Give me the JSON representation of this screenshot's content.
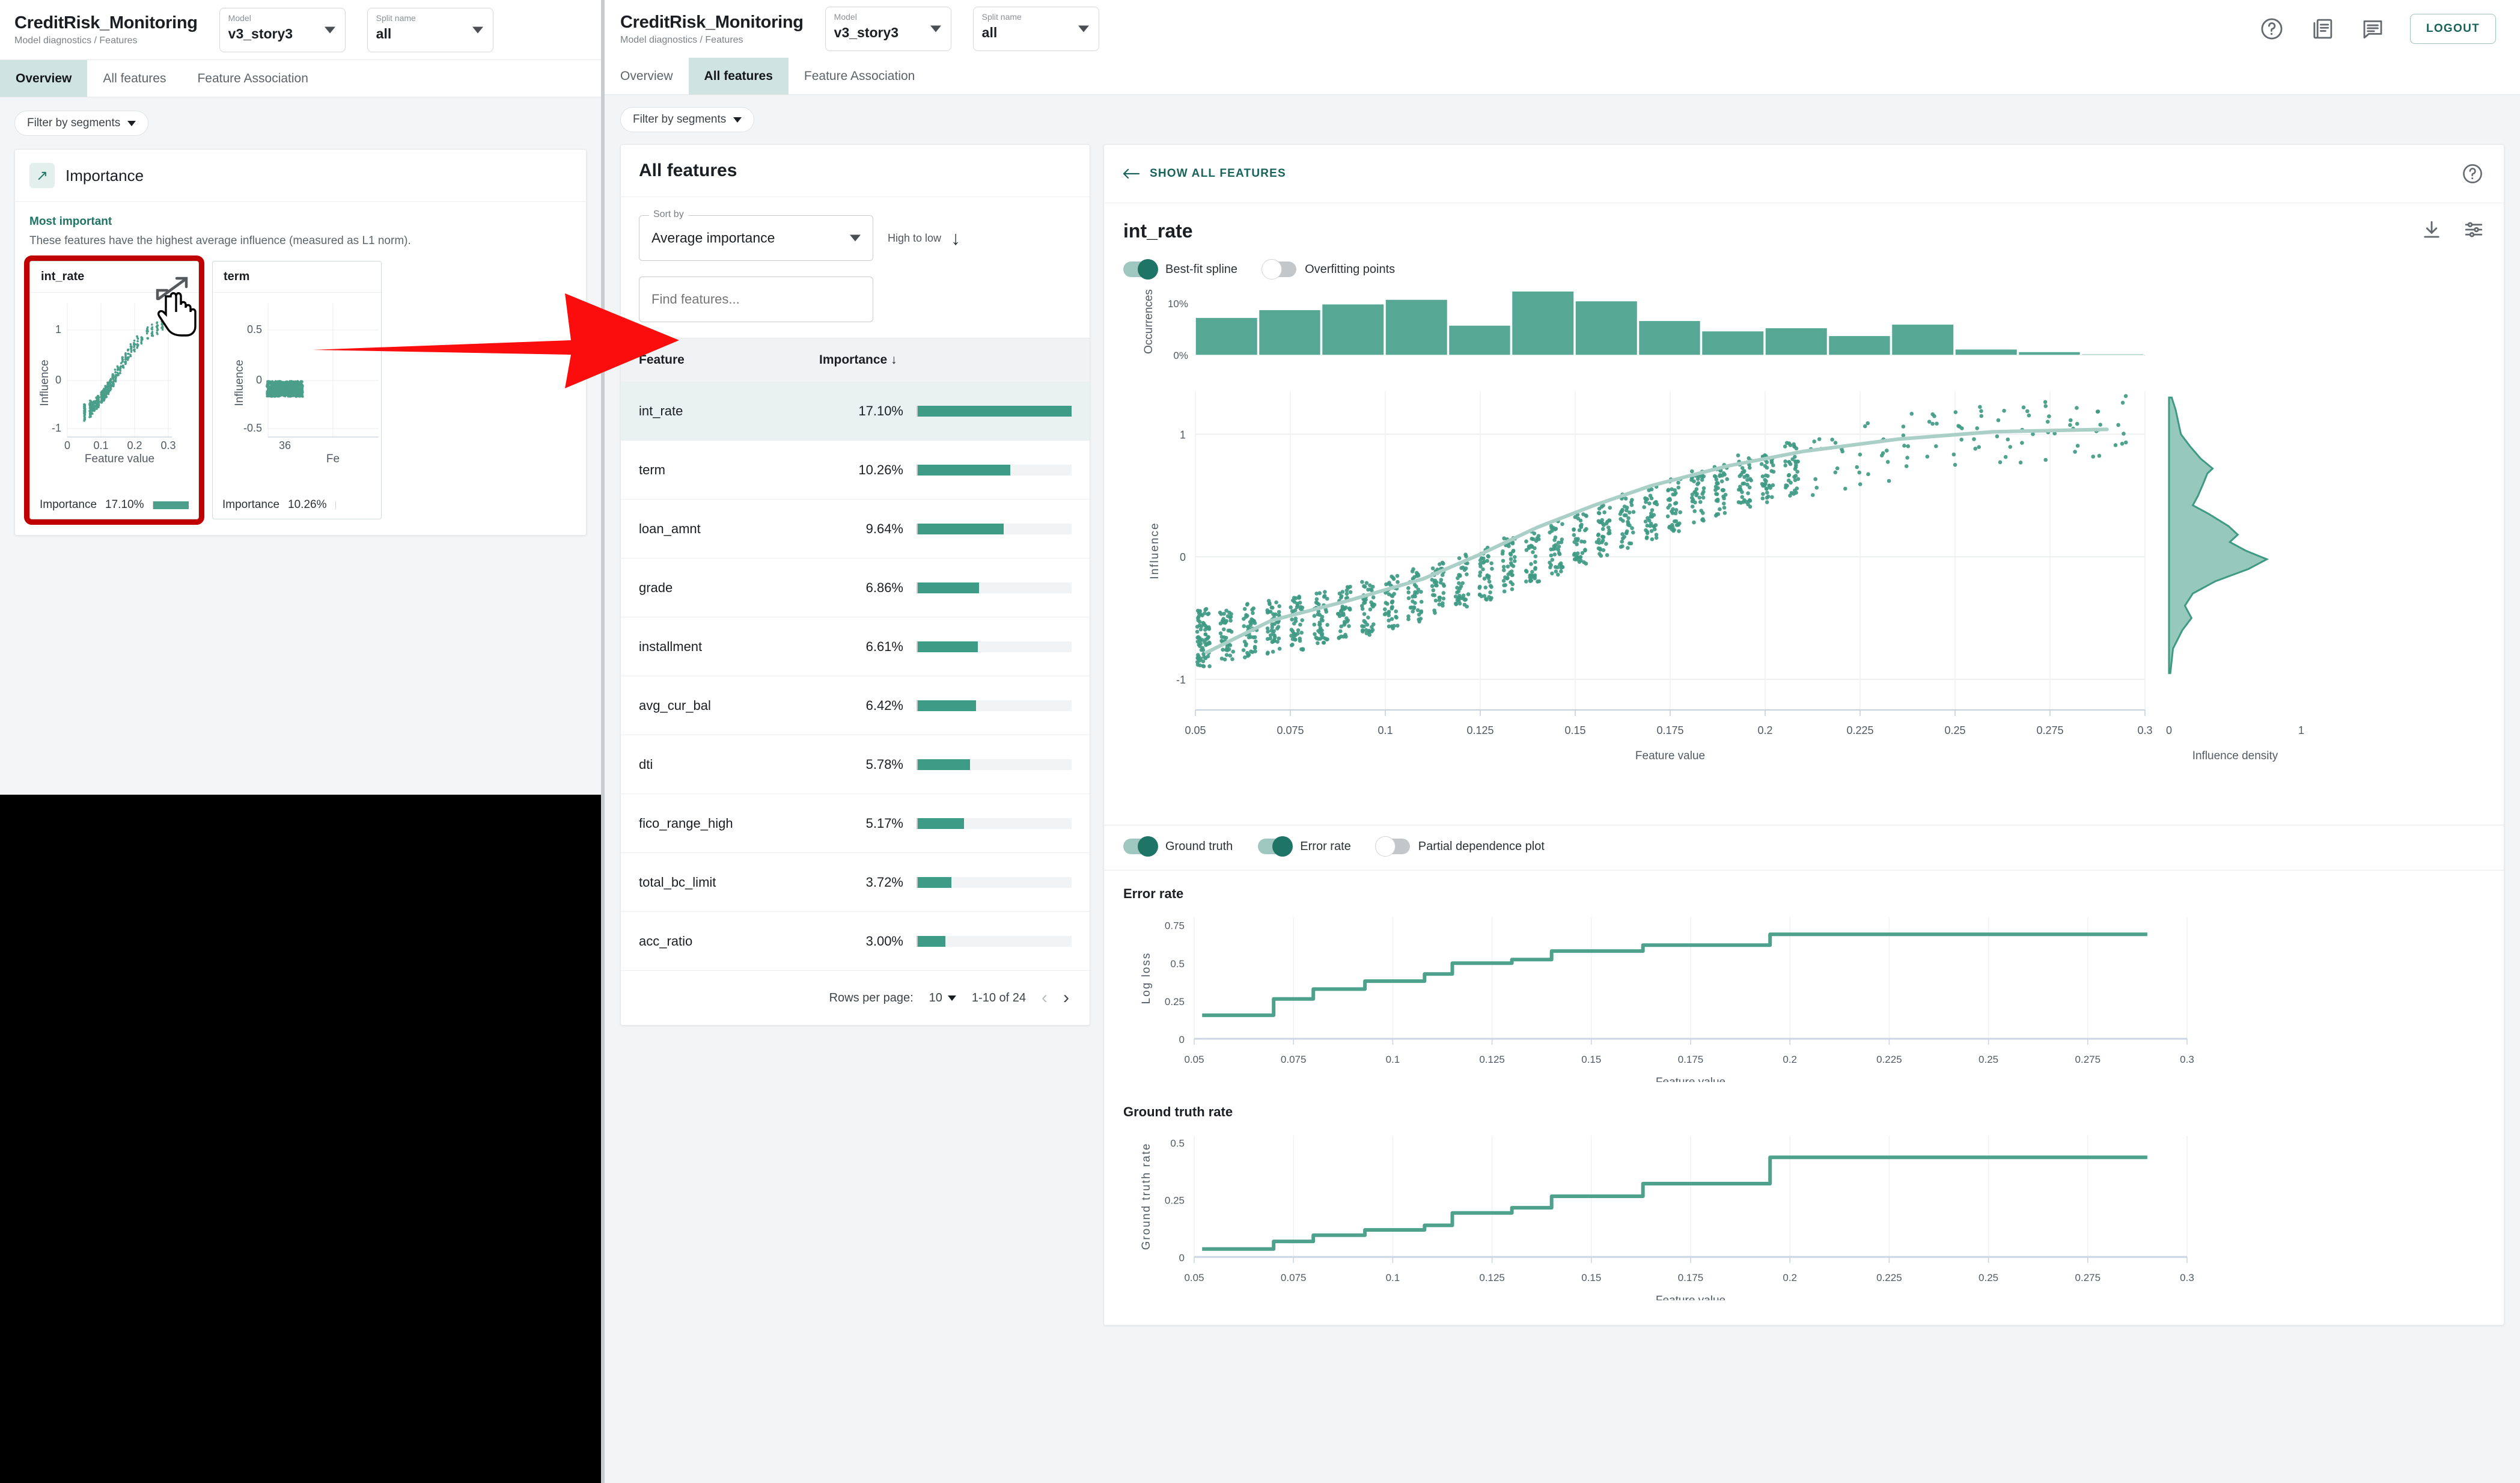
{
  "app": {
    "title": "CreditRisk_Monitoring",
    "breadcrumb": "Model diagnostics / Features",
    "model_label": "Model",
    "model_value": "v3_story3",
    "split_label": "Split name",
    "split_value": "all",
    "logout_label": "LOGOUT"
  },
  "tabs": {
    "overview": "Overview",
    "all_features": "All features",
    "feature_association": "Feature Association"
  },
  "toolbar": {
    "filter_segments": "Filter by segments"
  },
  "left_window": {
    "importance_card_title": "Importance",
    "most_important": "Most important",
    "most_important_desc": "These features have the highest average influence (measured as L1 norm).",
    "importance_label": "Importance",
    "mini_cards": [
      {
        "feature": "int_rate",
        "importance": "17.10%",
        "importance_pct": 100,
        "xlabel": "Feature value",
        "ylabel": "Influence",
        "xticks": [
          "0",
          "0.1",
          "0.2",
          "0.3"
        ],
        "yticks": [
          "1",
          "0",
          "-1"
        ]
      },
      {
        "feature": "term",
        "importance": "10.26%",
        "importance_pct": 60,
        "xlabel": "Feature value",
        "ylabel": "Influence",
        "xticks": [
          "36"
        ],
        "yticks": [
          "0.5",
          "0",
          "-0.5"
        ]
      }
    ]
  },
  "features_panel": {
    "title": "All features",
    "sort_legend": "Sort by",
    "sort_value": "Average importance",
    "sort_direction": "High to low",
    "search_placeholder": "Find features...",
    "col_feature": "Feature",
    "col_importance": "Importance",
    "rows": [
      {
        "feature": "int_rate",
        "importance": "17.10%",
        "pct": 100
      },
      {
        "feature": "term",
        "importance": "10.26%",
        "pct": 60
      },
      {
        "feature": "loan_amnt",
        "importance": "9.64%",
        "pct": 56
      },
      {
        "feature": "grade",
        "importance": "6.86%",
        "pct": 40
      },
      {
        "feature": "installment",
        "importance": "6.61%",
        "pct": 39
      },
      {
        "feature": "avg_cur_bal",
        "importance": "6.42%",
        "pct": 38
      },
      {
        "feature": "dti",
        "importance": "5.78%",
        "pct": 34
      },
      {
        "feature": "fico_range_high",
        "importance": "5.17%",
        "pct": 30
      },
      {
        "feature": "total_bc_limit",
        "importance": "3.72%",
        "pct": 22
      },
      {
        "feature": "acc_ratio",
        "importance": "3.00%",
        "pct": 18
      }
    ],
    "rows_per_page_label": "Rows per page:",
    "rows_per_page_value": "10",
    "range_label": "1-10 of 24"
  },
  "detail_panel": {
    "show_all_features": "SHOW ALL FEATURES",
    "feature_name": "int_rate",
    "toggles_top": [
      {
        "label": "Best-fit spline",
        "on": true
      },
      {
        "label": "Overfitting points",
        "on": false
      }
    ],
    "toggles_bottom": [
      {
        "label": "Ground truth",
        "on": true
      },
      {
        "label": "Error rate",
        "on": true
      },
      {
        "label": "Partial dependence plot",
        "on": false
      }
    ]
  },
  "chart_data": [
    {
      "id": "feature-histogram",
      "type": "bar",
      "title": "",
      "xlabel": "",
      "ylabel": "Occurrences",
      "yticks": [
        "0%",
        "10%"
      ],
      "ylim": [
        0,
        13
      ],
      "xlim": [
        0.05,
        0.3
      ],
      "bin_edges": [
        0.05,
        0.0667,
        0.0833,
        0.1,
        0.1167,
        0.1333,
        0.15,
        0.1667,
        0.1833,
        0.2,
        0.2167,
        0.2333,
        0.25,
        0.2667,
        0.2833,
        0.3
      ],
      "values": [
        7.3,
        8.8,
        9.9,
        10.8,
        5.8,
        12.4,
        10.5,
        6.7,
        4.7,
        5.3,
        3.8,
        6.0,
        1.2,
        0.7,
        0.25
      ]
    },
    {
      "id": "influence-scatter",
      "type": "scatter",
      "title": "int_rate",
      "xlabel": "Feature value",
      "ylabel": "Influence",
      "xticks": [
        "0.05",
        "0.075",
        "0.1",
        "0.125",
        "0.15",
        "0.175",
        "0.2",
        "0.225",
        "0.25",
        "0.275",
        "0.3"
      ],
      "yticks": [
        "1",
        "0",
        "-1"
      ],
      "xlim": [
        0.05,
        0.3
      ],
      "ylim": [
        -1.25,
        1.35
      ],
      "spline_label": "Best-fit spline",
      "spline_points": [
        [
          0.053,
          -0.78
        ],
        [
          0.07,
          -0.52
        ],
        [
          0.09,
          -0.36
        ],
        [
          0.11,
          -0.18
        ],
        [
          0.125,
          0.02
        ],
        [
          0.14,
          0.24
        ],
        [
          0.155,
          0.42
        ],
        [
          0.17,
          0.58
        ],
        [
          0.19,
          0.74
        ],
        [
          0.21,
          0.86
        ],
        [
          0.235,
          0.96
        ],
        [
          0.26,
          1.02
        ],
        [
          0.29,
          1.04
        ]
      ]
    },
    {
      "id": "influence-density",
      "type": "area",
      "xlabel": "Influence density",
      "xticks": [
        "0",
        "1"
      ],
      "xlim": [
        0,
        1
      ],
      "ylim": [
        -1.25,
        1.35
      ],
      "density": [
        [
          1.3,
          0.02
        ],
        [
          1.2,
          0.05
        ],
        [
          1.1,
          0.07
        ],
        [
          1.0,
          0.09
        ],
        [
          0.9,
          0.16
        ],
        [
          0.8,
          0.24
        ],
        [
          0.72,
          0.33
        ],
        [
          0.68,
          0.29
        ],
        [
          0.6,
          0.26
        ],
        [
          0.5,
          0.22
        ],
        [
          0.42,
          0.18
        ],
        [
          0.35,
          0.3
        ],
        [
          0.25,
          0.45
        ],
        [
          0.18,
          0.52
        ],
        [
          0.12,
          0.46
        ],
        [
          0.05,
          0.58
        ],
        [
          -0.02,
          0.74
        ],
        [
          -0.1,
          0.6
        ],
        [
          -0.2,
          0.35
        ],
        [
          -0.3,
          0.18
        ],
        [
          -0.4,
          0.12
        ],
        [
          -0.5,
          0.17
        ],
        [
          -0.6,
          0.1
        ],
        [
          -0.75,
          0.03
        ],
        [
          -0.95,
          0.01
        ]
      ]
    },
    {
      "id": "error-rate",
      "type": "line",
      "title": "Error rate",
      "xlabel": "Feature value",
      "ylabel": "Log loss",
      "yticks": [
        "0",
        "0.25",
        "0.5",
        "0.75"
      ],
      "xticks": [
        "0.05",
        "0.075",
        "0.1",
        "0.125",
        "0.15",
        "0.175",
        "0.2",
        "0.225",
        "0.25",
        "0.275",
        "0.3"
      ],
      "ylim": [
        0,
        0.8
      ],
      "xlim": [
        0.05,
        0.3
      ],
      "steps": [
        [
          0.052,
          0.155
        ],
        [
          0.07,
          0.155
        ],
        [
          0.07,
          0.262
        ],
        [
          0.08,
          0.262
        ],
        [
          0.08,
          0.327
        ],
        [
          0.093,
          0.327
        ],
        [
          0.093,
          0.38
        ],
        [
          0.108,
          0.38
        ],
        [
          0.108,
          0.427
        ],
        [
          0.115,
          0.427
        ],
        [
          0.115,
          0.498
        ],
        [
          0.13,
          0.498
        ],
        [
          0.13,
          0.522
        ],
        [
          0.14,
          0.522
        ],
        [
          0.14,
          0.578
        ],
        [
          0.163,
          0.578
        ],
        [
          0.163,
          0.617
        ],
        [
          0.195,
          0.617
        ],
        [
          0.195,
          0.688
        ],
        [
          0.29,
          0.688
        ]
      ]
    },
    {
      "id": "ground-truth-rate",
      "type": "line",
      "title": "Ground truth rate",
      "xlabel": "Feature value",
      "ylabel": "Ground truth rate",
      "yticks": [
        "0",
        "0.25",
        "0.5"
      ],
      "xticks": [
        "0.05",
        "0.075",
        "0.1",
        "0.125",
        "0.15",
        "0.175",
        "0.2",
        "0.225",
        "0.25",
        "0.275",
        "0.3"
      ],
      "ylim": [
        0,
        0.53
      ],
      "xlim": [
        0.05,
        0.3
      ],
      "steps": [
        [
          0.052,
          0.035
        ],
        [
          0.07,
          0.035
        ],
        [
          0.07,
          0.068
        ],
        [
          0.08,
          0.068
        ],
        [
          0.08,
          0.095
        ],
        [
          0.093,
          0.095
        ],
        [
          0.093,
          0.118
        ],
        [
          0.108,
          0.118
        ],
        [
          0.108,
          0.138
        ],
        [
          0.115,
          0.138
        ],
        [
          0.115,
          0.192
        ],
        [
          0.13,
          0.192
        ],
        [
          0.13,
          0.215
        ],
        [
          0.14,
          0.215
        ],
        [
          0.14,
          0.265
        ],
        [
          0.163,
          0.265
        ],
        [
          0.163,
          0.32
        ],
        [
          0.195,
          0.32
        ],
        [
          0.195,
          0.435
        ],
        [
          0.29,
          0.435
        ]
      ]
    }
  ],
  "colors": {
    "accent_green": "#3e9b85",
    "teal_dark": "#1f7565",
    "highlight_red": "#c00000",
    "tab_active_bg": "#cfe3e0"
  }
}
